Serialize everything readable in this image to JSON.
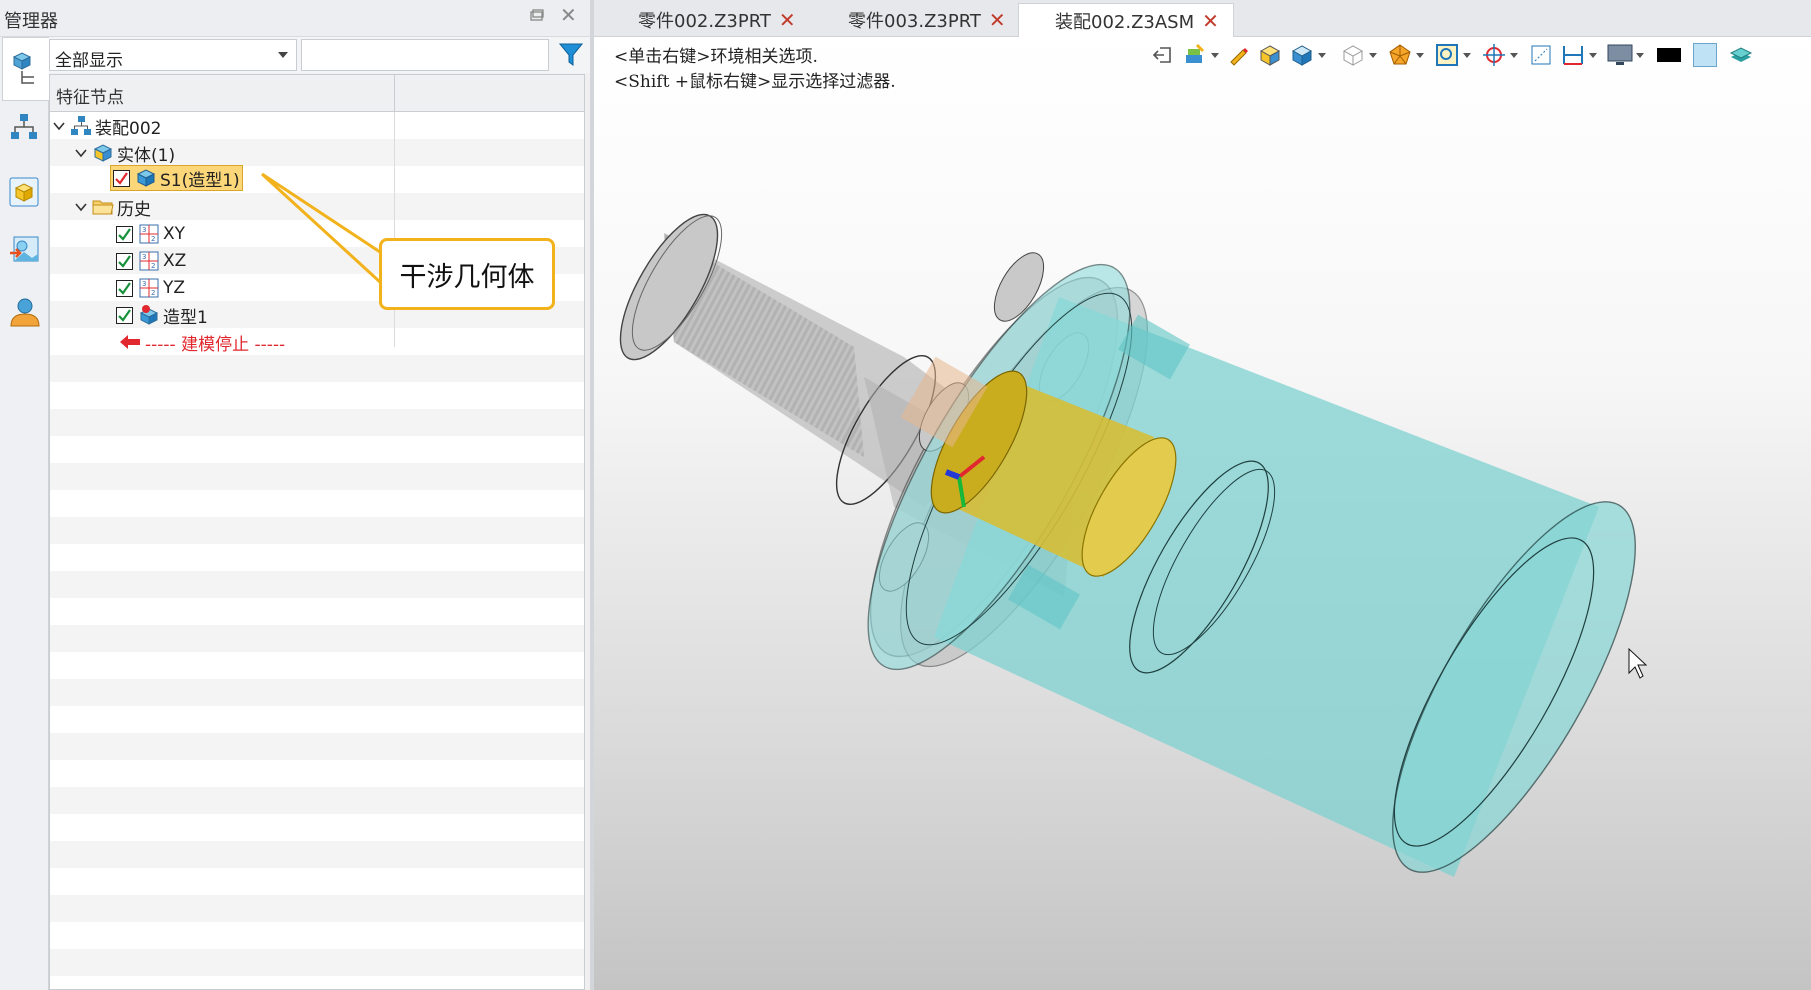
{
  "manager": {
    "title": "管理器",
    "display_filter": "全部显示",
    "search_placeholder": "",
    "column_header": "特征节点"
  },
  "tree": {
    "root": "装配002",
    "solid_group": "实体(1)",
    "solid_item": "S1(造型1)",
    "history_group": "历史",
    "xy": "XY",
    "xz": "XZ",
    "yz": "YZ",
    "shape": "造型1",
    "stop_marker": "----- 建模停止 -----"
  },
  "callout": {
    "text": "干涉几何体"
  },
  "tabs": [
    {
      "label": "零件002.Z3PRT"
    },
    {
      "label": "零件003.Z3PRT"
    },
    {
      "label": "装配002.Z3ASM"
    }
  ],
  "viewport": {
    "hint1": "<单击右键>环境相关选项.",
    "hint2": "<Shift +鼠标右键>显示选择过滤器."
  },
  "colors": {
    "cyan_body": "#7fd2d2",
    "yellow_interference": "#d6be36",
    "callout_border": "#f2b21b",
    "stop_red": "#e0282e"
  }
}
